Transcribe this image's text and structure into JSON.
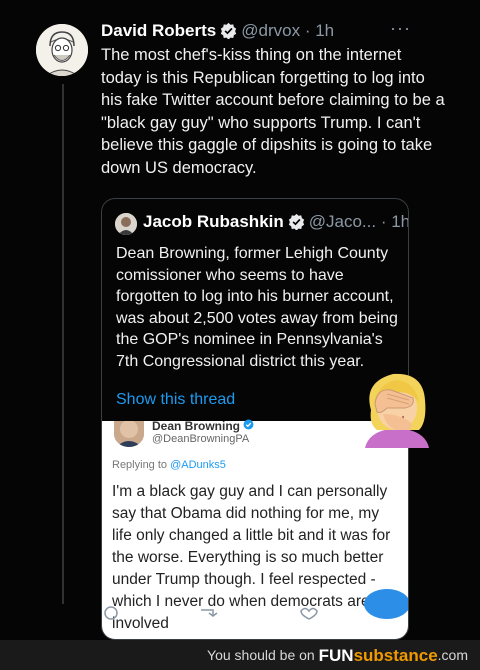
{
  "tweet": {
    "name": "David Roberts",
    "handle": "@drvox",
    "time": "· 1h",
    "more": "···",
    "body": "The most chef's-kiss thing on the internet today is this Republican forgetting to log into his fake Twitter account before claiming to be a \"black gay guy\" who supports Trump. I can't believe this gaggle of dipshits is going to take down US democracy."
  },
  "quote": {
    "name": "Jacob Rubashkin",
    "handle": "@Jaco...",
    "time": "· 1h",
    "body": "Dean Browning, former Lehigh County comissioner who seems to have forgotten to log into his burner account, was about 2,500 votes away from being the GOP's nominee in Pennsylvania's 7th Congressional district this year.",
    "show_thread": "Show this thread"
  },
  "screenshot": {
    "name": "Dean Browning",
    "handle": "@DeanBrowningPA",
    "replying_prefix": "Replying to ",
    "replying_handle": "@ADunks5",
    "body": "I'm a black gay guy and I can personally say that Obama did nothing for me, my life only changed a little bit and it was for the worse. Everything is so much better under Trump though. I feel respected - which I never do when democrats are involved"
  },
  "emoji": "facepalm-emoji",
  "footer": {
    "prefix": "You should be on ",
    "brand_fun": "FUN",
    "brand_sub": "substance",
    "brand_com": ".com"
  },
  "colors": {
    "background": "#000000",
    "link": "#1d9bf0",
    "verified": "#1d9bf0",
    "brand_accent": "#f09a00"
  }
}
